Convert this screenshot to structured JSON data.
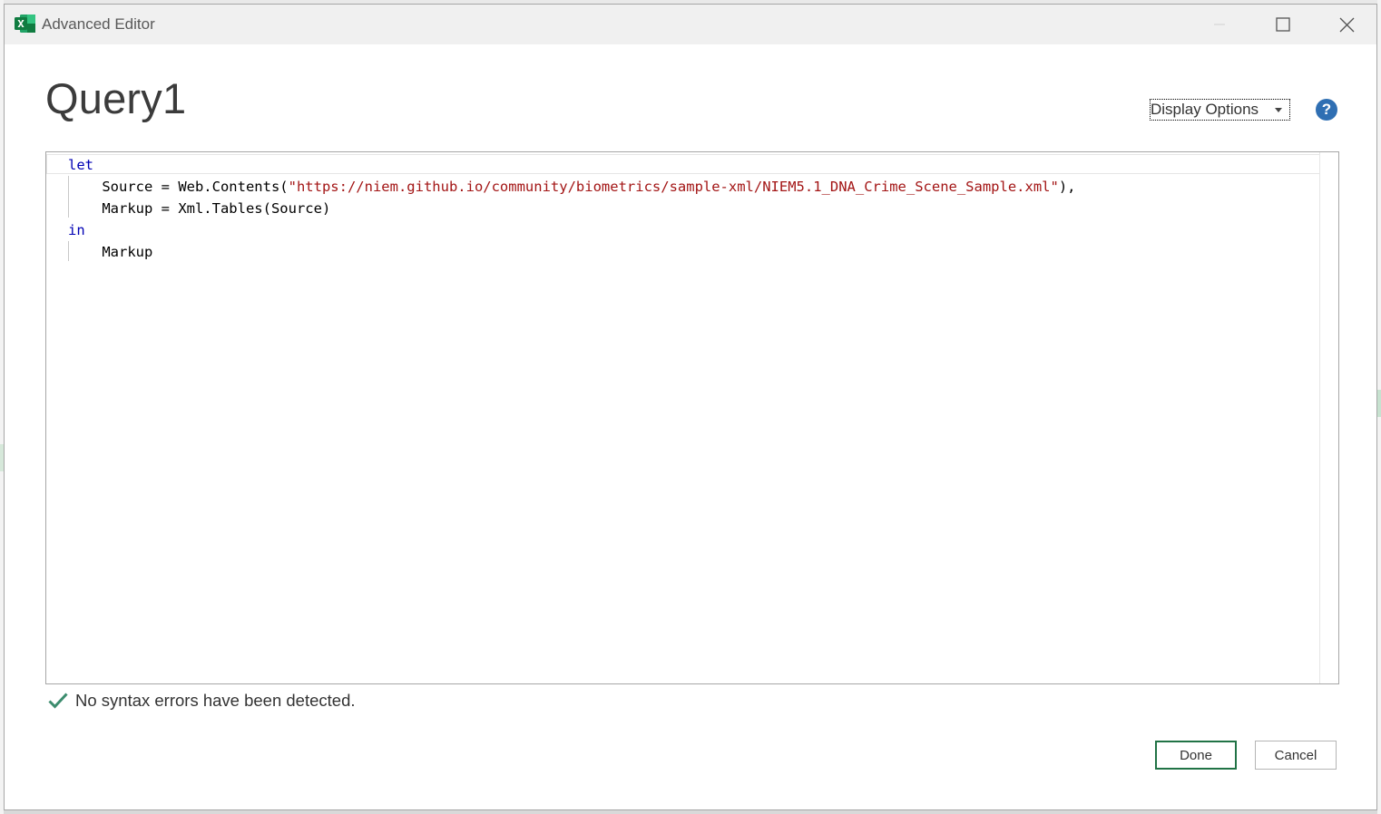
{
  "window": {
    "title": "Advanced Editor"
  },
  "query": {
    "title": "Query1"
  },
  "toolbar": {
    "display_options_label": "Display Options",
    "help_label": "?"
  },
  "editor": {
    "lines": [
      {
        "indent": "",
        "tokens": [
          {
            "text": "let",
            "kind": "keyword"
          }
        ]
      },
      {
        "indent": "    ",
        "tokens": [
          {
            "text": "Source = Web.Contents(",
            "kind": "plain"
          },
          {
            "text": "\"https://niem.github.io/community/biometrics/sample-xml/NIEM5.1_DNA_Crime_Scene_Sample.xml\"",
            "kind": "string"
          },
          {
            "text": "),",
            "kind": "plain"
          }
        ]
      },
      {
        "indent": "    ",
        "tokens": [
          {
            "text": "Markup = Xml.Tables(Source)",
            "kind": "plain"
          }
        ]
      },
      {
        "indent": "",
        "tokens": [
          {
            "text": "in",
            "kind": "keyword"
          }
        ]
      },
      {
        "indent": "    ",
        "tokens": [
          {
            "text": "Markup",
            "kind": "plain"
          }
        ]
      }
    ]
  },
  "status": {
    "message": "No syntax errors have been detected."
  },
  "buttons": {
    "done_label": "Done",
    "cancel_label": "Cancel"
  },
  "colors": {
    "accent": "#217346",
    "keyword": "#0000b4",
    "string": "#a31515",
    "help": "#2f6fb3",
    "check": "#3c8c6e"
  }
}
